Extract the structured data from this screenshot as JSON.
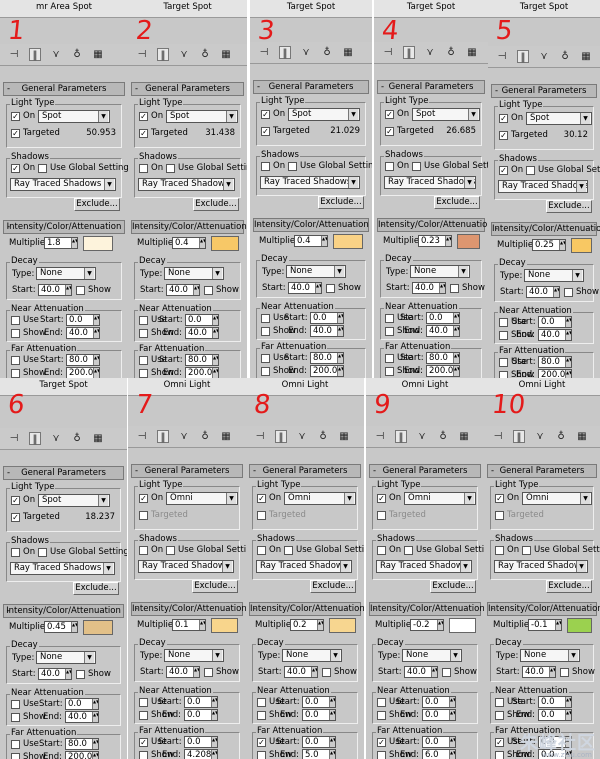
{
  "watermark": {
    "text": "朱峰社区",
    "url": "www.zfsu.com"
  },
  "common": {
    "general_parameters": "General Parameters",
    "light_type": "Light Type",
    "on": "On",
    "targeted": "Targeted",
    "shadows": "Shadows",
    "use_global": "Use Global Settings",
    "shadow_type": "Ray Traced Shadows",
    "exclude": "Exclude...",
    "intensity": "Intensity/Color/Attenuation",
    "multiplier": "Multiplier:",
    "decay": "Decay",
    "type": "Type:",
    "decay_type": "None",
    "start": "Start:",
    "show": "Show",
    "near_att": "Near Attenuation",
    "far_att": "Far Attenuation",
    "use": "Use",
    "end": "End:",
    "minus": "-"
  },
  "panels": [
    {
      "number": "1",
      "title": "mr Area Spot",
      "light": "Spot",
      "targeted_on": true,
      "target_value": "50.953",
      "shadows_on": true,
      "multiplier": "1.8",
      "swatch": "#fdf3dc",
      "decay_start": "40.0",
      "near_start": "0.0",
      "near_end": "40.0",
      "far_use": false,
      "far_show": false,
      "far_start": "80.0",
      "far_end": "200.0"
    },
    {
      "number": "2",
      "title": "Target Spot",
      "light": "Spot",
      "targeted_on": true,
      "target_value": "31.438",
      "shadows_on": false,
      "multiplier": "0.4",
      "swatch": "#f7c867",
      "decay_start": "40.0",
      "near_start": "0.0",
      "near_end": "40.0",
      "far_use": false,
      "far_show": false,
      "far_start": "80.0",
      "far_end": "200.0"
    },
    {
      "number": "3",
      "title": "Target Spot",
      "light": "Spot",
      "targeted_on": true,
      "target_value": "21.029",
      "shadows_on": false,
      "multiplier": "0.4",
      "swatch": "#f9d286",
      "decay_start": "40.0",
      "near_start": "0.0",
      "near_end": "40.0",
      "far_use": false,
      "far_show": false,
      "far_start": "80.0",
      "far_end": "200.0"
    },
    {
      "number": "4",
      "title": "Target Spot",
      "light": "Spot",
      "targeted_on": true,
      "target_value": "26.685",
      "shadows_on": false,
      "multiplier": "0.23",
      "swatch": "#dd9670",
      "decay_start": "40.0",
      "near_start": "0.0",
      "near_end": "40.0",
      "far_use": false,
      "far_show": false,
      "far_start": "80.0",
      "far_end": "200.0"
    },
    {
      "number": "5",
      "title": "Target Spot",
      "light": "Spot",
      "targeted_on": true,
      "target_value": "30.12",
      "shadows_on": true,
      "multiplier": "0.25",
      "swatch": "#f8c863",
      "decay_start": "40.0",
      "near_start": "0.0",
      "near_end": "40.0",
      "far_use": false,
      "far_show": false,
      "far_start": "80.0",
      "far_end": "200.0"
    },
    {
      "number": "6",
      "title": "Target Spot",
      "light": "Spot",
      "targeted_on": true,
      "target_value": "18.237",
      "shadows_on": false,
      "multiplier": "0.45",
      "swatch": "#e2c088",
      "decay_start": "40.0",
      "near_start": "0.0",
      "near_end": "40.0",
      "far_use": false,
      "far_show": false,
      "far_start": "80.0",
      "far_end": "200.0"
    },
    {
      "number": "7",
      "title": "Omni Light",
      "light": "Omni",
      "targeted_on": false,
      "target_value": "",
      "shadows_on": false,
      "multiplier": "0.1",
      "swatch": "#f8d58c",
      "decay_start": "40.0",
      "near_start": "0.0",
      "near_end": "0.0",
      "far_use": true,
      "far_show": false,
      "far_start": "0.0",
      "far_end": "4.208"
    },
    {
      "number": "8",
      "title": "Omni Light",
      "light": "Omni",
      "targeted_on": false,
      "target_value": "",
      "shadows_on": false,
      "multiplier": "0.2",
      "swatch": "#f7d690",
      "decay_start": "40.0",
      "near_start": "0.0",
      "near_end": "0.0",
      "far_use": true,
      "far_show": false,
      "far_start": "0.0",
      "far_end": "5.0"
    },
    {
      "number": "9",
      "title": "Omni Light",
      "light": "Omni",
      "targeted_on": false,
      "target_value": "",
      "shadows_on": false,
      "multiplier": "-0.2",
      "swatch": "#ffffff",
      "decay_start": "40.0",
      "near_start": "0.0",
      "near_end": "0.0",
      "far_use": true,
      "far_show": false,
      "far_start": "0.0",
      "far_end": "6.0"
    },
    {
      "number": "10",
      "title": "Omni Light",
      "light": "Omni",
      "targeted_on": false,
      "target_value": "",
      "shadows_on": false,
      "multiplier": "-0.1",
      "swatch": "#9bd14f",
      "decay_start": "40.0",
      "near_start": "0.0",
      "near_end": "0.0",
      "far_use": true,
      "far_show": false,
      "far_start": "0.0",
      "far_end": "0.0"
    }
  ]
}
